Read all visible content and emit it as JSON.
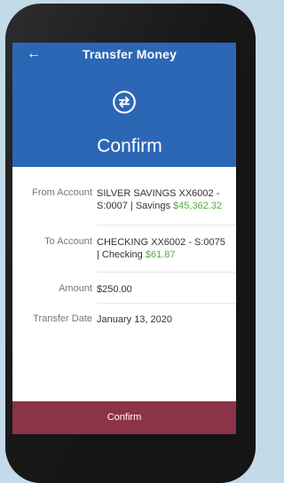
{
  "header": {
    "back_icon": "arrow-left-icon",
    "title": "Transfer Money",
    "swap_icon": "swap-arrows-icon",
    "heading": "Confirm"
  },
  "details": {
    "from": {
      "label": "From Account",
      "value": "SILVER SAVINGS XX6002 - S:0007 | Savings",
      "amount": "$45,362.32"
    },
    "to": {
      "label": "To Account",
      "value": "CHECKING XX6002 - S:0075 | Checking",
      "amount": "$61.87"
    },
    "amount": {
      "label": "Amount",
      "value": "$250.00"
    },
    "date": {
      "label": "Transfer Date",
      "value": "January 13, 2020"
    }
  },
  "footer": {
    "confirm_label": "Confirm"
  },
  "colors": {
    "header_bg": "#2c67b5",
    "confirm_bg": "#8b3347",
    "balance_green": "#5aa64a"
  }
}
